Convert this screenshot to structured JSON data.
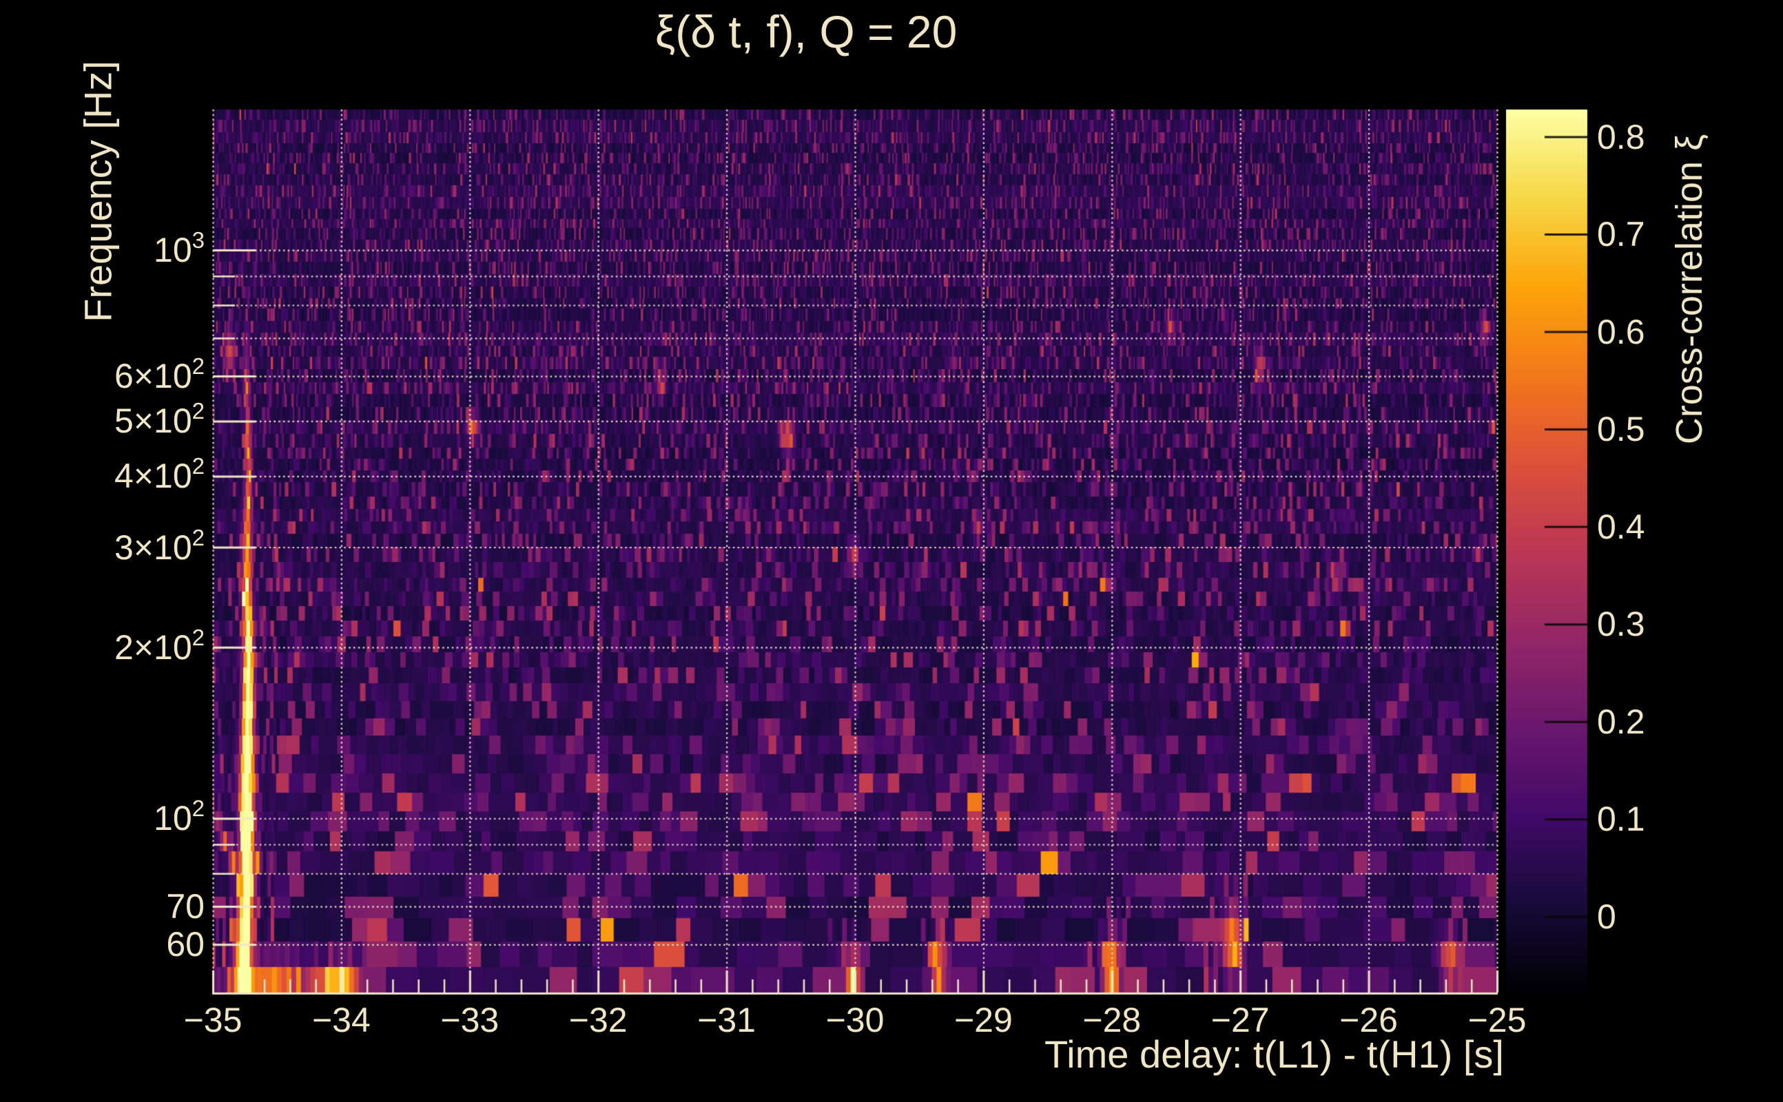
{
  "chart_data": {
    "type": "heatmap",
    "title": "ξ(δ t, f), Q = 20",
    "xlabel": "Time delay: t(L1) - t(H1) [s]",
    "ylabel": "Frequency [Hz]",
    "colorbar_label": "Cross-correlation ξ",
    "x_range": [
      -35,
      -25
    ],
    "y_range_hz": [
      49.4,
      1767
    ],
    "y_scale": "log",
    "x_minor_step_s": 0.2,
    "color_range": [
      -0.078,
      0.828
    ],
    "grid": "dotted",
    "legend_position": "right-colorbar",
    "text_color": "#F0E6C6",
    "grid_color": "#F4ECD2",
    "background": "#000000",
    "colormap": "inferno",
    "colormap_stops": [
      [
        0,
        0,
        4
      ],
      [
        22,
        11,
        57
      ],
      [
        66,
        10,
        104
      ],
      [
        106,
        23,
        110
      ],
      [
        147,
        38,
        103
      ],
      [
        188,
        55,
        84
      ],
      [
        221,
        81,
        58
      ],
      [
        243,
        120,
        25
      ],
      [
        252,
        165,
        10
      ],
      [
        246,
        215,
        70
      ],
      [
        252,
        255,
        164
      ]
    ],
    "x_ticks": [
      {
        "t": -35,
        "label": "−35"
      },
      {
        "t": -34,
        "label": "−34"
      },
      {
        "t": -33,
        "label": "−33"
      },
      {
        "t": -32,
        "label": "−32"
      },
      {
        "t": -31,
        "label": "−31"
      },
      {
        "t": -30,
        "label": "−30"
      },
      {
        "t": -29,
        "label": "−29"
      },
      {
        "t": -28,
        "label": "−28"
      },
      {
        "t": -27,
        "label": "−27"
      },
      {
        "t": -26,
        "label": "−26"
      },
      {
        "t": -25,
        "label": "−25"
      }
    ],
    "y_ticks": [
      {
        "f": 1000,
        "major": true,
        "base": "10",
        "sup": "3"
      },
      {
        "f": 900,
        "major": false
      },
      {
        "f": 800,
        "major": false
      },
      {
        "f": 700,
        "major": false
      },
      {
        "f": 600,
        "major": true,
        "base": "6×10",
        "sup": "2"
      },
      {
        "f": 500,
        "major": true,
        "base": "5×10",
        "sup": "2"
      },
      {
        "f": 400,
        "major": true,
        "base": "4×10",
        "sup": "2"
      },
      {
        "f": 300,
        "major": true,
        "base": "3×10",
        "sup": "2"
      },
      {
        "f": 200,
        "major": true,
        "base": "2×10",
        "sup": "2"
      },
      {
        "f": 100,
        "major": true,
        "base": "10",
        "sup": "2"
      },
      {
        "f": 90,
        "major": false
      },
      {
        "f": 80,
        "major": false
      },
      {
        "f": 70,
        "major": true,
        "base": "70"
      },
      {
        "f": 60,
        "major": true,
        "base": "60"
      }
    ],
    "colorbar_ticks": [
      {
        "v": 0.8,
        "label": "0.8"
      },
      {
        "v": 0.7,
        "label": "0.7"
      },
      {
        "v": 0.6,
        "label": "0.6"
      },
      {
        "v": 0.5,
        "label": "0.5"
      },
      {
        "v": 0.4,
        "label": "0.4"
      },
      {
        "v": 0.3,
        "label": "0.3"
      },
      {
        "v": 0.2,
        "label": "0.2"
      },
      {
        "v": 0.1,
        "label": "0.1"
      },
      {
        "v": 0.0,
        "label": "0"
      }
    ],
    "main_streak": {
      "t": -34.74,
      "f_min": 50,
      "f_max": 640,
      "peak_xi": 0.95,
      "profile": [
        [
          640,
          0.18
        ],
        [
          500,
          0.34
        ],
        [
          300,
          0.56
        ],
        [
          200,
          0.78
        ],
        [
          150,
          0.95
        ],
        [
          95,
          0.95
        ],
        [
          65,
          0.9
        ],
        [
          50,
          0.88
        ]
      ]
    },
    "hotspots": [
      {
        "t": -34.87,
        "f": 660,
        "xi": 0.42,
        "st": 0.03,
        "slf": 0.02
      },
      {
        "t": -32.98,
        "f": 490,
        "xi": 0.4,
        "st": 0.03,
        "slf": 0.018
      },
      {
        "t": -31.51,
        "f": 580,
        "xi": 0.32,
        "st": 0.025,
        "slf": 0.015
      },
      {
        "t": -30.52,
        "f": 470,
        "xi": 0.42,
        "st": 0.03,
        "slf": 0.02
      },
      {
        "t": -30.01,
        "f": 290,
        "xi": 0.38,
        "st": 0.03,
        "slf": 0.018
      },
      {
        "t": -29.04,
        "f": 325,
        "xi": 0.3,
        "st": 0.025,
        "slf": 0.015
      },
      {
        "t": -32.9,
        "f": 153,
        "xi": 0.36,
        "st": 0.035,
        "slf": 0.016
      },
      {
        "t": -29.6,
        "f": 128,
        "xi": 0.32,
        "st": 0.045,
        "slf": 0.018
      },
      {
        "t": -26.85,
        "f": 620,
        "xi": 0.33,
        "st": 0.025,
        "slf": 0.022
      },
      {
        "t": -25.1,
        "f": 724,
        "xi": 0.28,
        "st": 0.025,
        "slf": 0.018
      },
      {
        "t": -27.54,
        "f": 730,
        "xi": 0.26,
        "st": 0.025,
        "slf": 0.018
      },
      {
        "t": -34.35,
        "f": 194,
        "xi": 0.27,
        "st": 0.03,
        "slf": 0.015
      },
      {
        "t": -26.25,
        "f": 264,
        "xi": 0.28,
        "st": 0.03,
        "slf": 0.015
      },
      {
        "t": -28.0,
        "f": 54,
        "xi": 0.62,
        "st": 0.05,
        "slf": 0.04
      },
      {
        "t": -27.06,
        "f": 61,
        "xi": 0.58,
        "st": 0.055,
        "slf": 0.035
      },
      {
        "t": -30.01,
        "f": 53,
        "xi": 0.52,
        "st": 0.05,
        "slf": 0.032
      },
      {
        "t": -29.34,
        "f": 55,
        "xi": 0.47,
        "st": 0.05,
        "slf": 0.03
      },
      {
        "t": -25.36,
        "f": 56,
        "xi": 0.46,
        "st": 0.05,
        "slf": 0.032
      },
      {
        "t": -26.01,
        "f": 55,
        "xi": 0.35,
        "st": 0.045,
        "slf": 0.028
      },
      {
        "t": -33.98,
        "f": 52,
        "xi": 0.44,
        "st": 0.075,
        "slf": 0.025
      },
      {
        "t": -33.73,
        "f": 58,
        "xi": 0.33,
        "st": 0.045,
        "slf": 0.025
      },
      {
        "t": -31.72,
        "f": 52,
        "xi": 0.36,
        "st": 0.05,
        "slf": 0.025
      },
      {
        "t": -30.89,
        "f": 73,
        "xi": 0.3,
        "st": 0.045,
        "slf": 0.025
      },
      {
        "t": -26.38,
        "f": 73,
        "xi": 0.3,
        "st": 0.04,
        "slf": 0.022
      },
      {
        "t": -25.18,
        "f": 81,
        "xi": 0.27,
        "st": 0.04,
        "slf": 0.02
      },
      {
        "t": -28.45,
        "f": 88,
        "xi": 0.27,
        "st": 0.04,
        "slf": 0.02
      },
      {
        "t": -32.2,
        "f": 89,
        "xi": 0.25,
        "st": 0.04,
        "slf": 0.02
      },
      {
        "t": -34.57,
        "f": 51,
        "xi": 0.48,
        "st": 0.18,
        "slf": 0.03
      },
      {
        "t": -34.08,
        "f": 52,
        "xi": 0.28,
        "st": 0.15,
        "slf": 0.018
      }
    ],
    "noise": {
      "seed": 77,
      "base": 0.022,
      "spike_pow": 6,
      "spike_amp": 0.3
    }
  }
}
